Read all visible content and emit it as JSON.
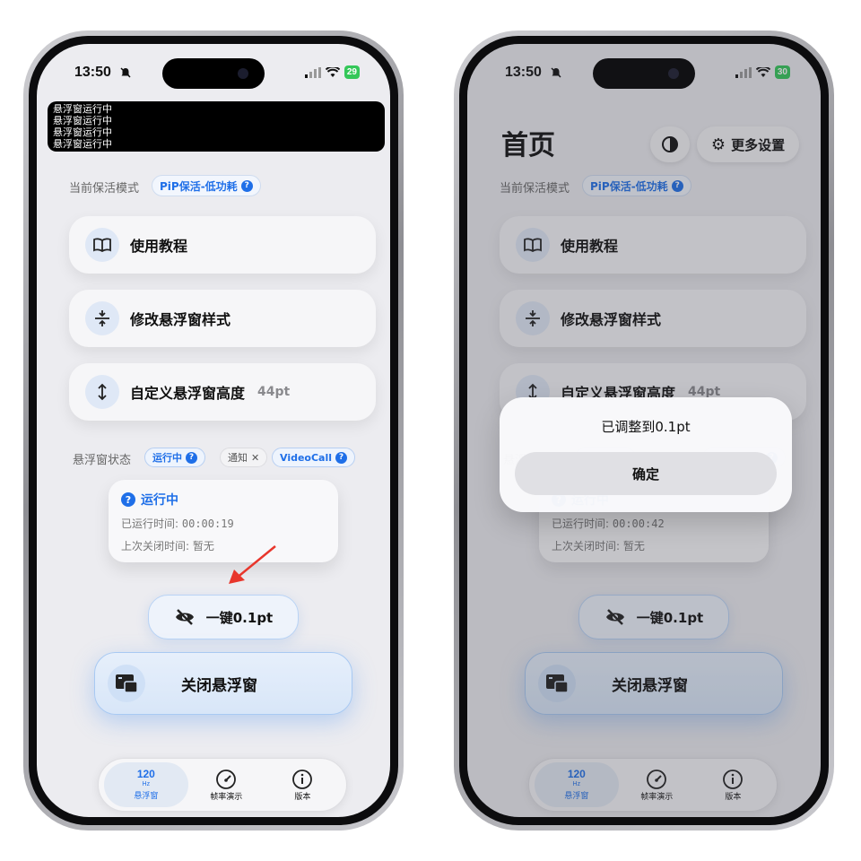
{
  "status_bar": {
    "time": "13:50"
  },
  "left": {
    "battery": "29",
    "black_overlay_lines": [
      "悬浮窗运行中",
      "悬浮窗运行中",
      "悬浮窗运行中",
      "悬浮窗运行中"
    ],
    "running_time": "00:00:19"
  },
  "right": {
    "battery": "30",
    "page_title": "首页",
    "more_settings": "更多设置",
    "running_time": "00:00:42",
    "alert": {
      "message": "已调整到0.1pt",
      "confirm": "确定"
    }
  },
  "keepalive": {
    "label": "当前保活模式",
    "mode": "PiP保活-低功耗"
  },
  "menu": [
    {
      "label": "使用教程",
      "icon": "book-icon"
    },
    {
      "label": "修改悬浮窗样式",
      "icon": "compress-icon"
    },
    {
      "label": "自定义悬浮窗高度",
      "value": "44pt",
      "icon": "height-arrow-icon"
    }
  ],
  "float_state": {
    "label": "悬浮窗状态",
    "tags": [
      "运行中",
      "通知",
      "VideoCall"
    ]
  },
  "info_card": {
    "title": "运行中",
    "runtime_label": "已运行时间:",
    "last_close_label": "上次关闭时间:",
    "last_close_value": "暂无"
  },
  "one_click_button": "一键0.1pt",
  "close_button": "关闭悬浮窗",
  "tabbar": {
    "tabs": [
      {
        "hz": "120",
        "hz_unit": "Hz",
        "label": "悬浮窗"
      },
      {
        "label": "帧率演示",
        "icon": "speedometer-icon"
      },
      {
        "label": "版本",
        "icon": "info-icon"
      }
    ]
  },
  "colors": {
    "accent": "#1f6fe8",
    "annotation_arrow": "#e8362c",
    "battery": "#34c759"
  }
}
